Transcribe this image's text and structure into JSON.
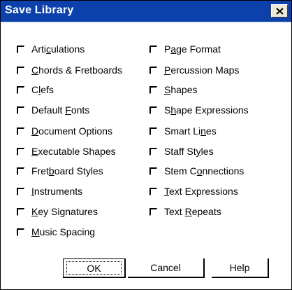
{
  "dialog": {
    "title": "Save Library",
    "close_label": "Close"
  },
  "options_left": [
    {
      "pre": "Arti",
      "key": "c",
      "post": "ulations",
      "checked": false
    },
    {
      "pre": "",
      "key": "C",
      "post": "hords & Fretboards",
      "checked": false
    },
    {
      "pre": "C",
      "key": "l",
      "post": "efs",
      "checked": false
    },
    {
      "pre": "Default ",
      "key": "F",
      "post": "onts",
      "checked": false
    },
    {
      "pre": "",
      "key": "D",
      "post": "ocument Options",
      "checked": false
    },
    {
      "pre": "",
      "key": "E",
      "post": "xecutable Shapes",
      "checked": false
    },
    {
      "pre": "Fret",
      "key": "b",
      "post": "oard Styles",
      "checked": false
    },
    {
      "pre": "",
      "key": "I",
      "post": "nstruments",
      "checked": false
    },
    {
      "pre": "",
      "key": "K",
      "post": "ey Signatures",
      "checked": false
    },
    {
      "pre": "",
      "key": "M",
      "post": "usic Spacing",
      "checked": false
    }
  ],
  "options_right": [
    {
      "pre": "P",
      "key": "a",
      "post": "ge Format",
      "checked": false
    },
    {
      "pre": "",
      "key": "P",
      "post": "ercussion Maps",
      "checked": false
    },
    {
      "pre": "",
      "key": "S",
      "post": "hapes",
      "checked": false
    },
    {
      "pre": "S",
      "key": "h",
      "post": "ape Expressions",
      "checked": false
    },
    {
      "pre": "Smart Li",
      "key": "n",
      "post": "es",
      "checked": false
    },
    {
      "pre": "Staff St",
      "key": "y",
      "post": "les",
      "checked": false
    },
    {
      "pre": "Stem C",
      "key": "o",
      "post": "nnections",
      "checked": false
    },
    {
      "pre": "",
      "key": "T",
      "post": "ext Expressions",
      "checked": false
    },
    {
      "pre": "Text ",
      "key": "R",
      "post": "epeats",
      "checked": false
    }
  ],
  "buttons": {
    "ok": "OK",
    "cancel": "Cancel",
    "help": "Help"
  },
  "colors": {
    "titlebar": "#0c40aa",
    "title_text": "#ffffff",
    "dialog_bg": "#ffffff"
  }
}
